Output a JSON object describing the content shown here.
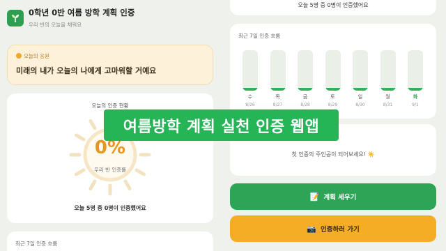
{
  "header": {
    "title": "0학년 0반 여름 방학 계획 인증",
    "subtitle": "우리 반의 오늘을 채워요",
    "logo_icon": "sprout-icon"
  },
  "cheer": {
    "label": "오늘의 응원",
    "message": "미래의 내가 오늘의 나에게 고마워할 거예요"
  },
  "status": {
    "title": "오늘의 인증 현황",
    "percent": "0%",
    "percent_value": 0,
    "percent_label": "우리 반 인증률",
    "summary": "오늘 5명 중 0명이 인증했어요"
  },
  "lower_left": {
    "title": "최근 7일 인증 흐름"
  },
  "right_top": {
    "text": "오늘 5명 중 0명이 인증했어요"
  },
  "week": {
    "title": "최근 7일 인증 흐름",
    "days": [
      {
        "name": "수",
        "date": "8/26",
        "rate": 0
      },
      {
        "name": "목",
        "date": "8/27",
        "rate": 0
      },
      {
        "name": "금",
        "date": "8/28",
        "rate": 0
      },
      {
        "name": "토",
        "date": "8/29",
        "rate": 0
      },
      {
        "name": "일",
        "date": "8/30",
        "rate": 0
      },
      {
        "name": "월",
        "date": "8/31",
        "rate": 0
      },
      {
        "name": "화",
        "date": "9/1",
        "rate": 0,
        "today": true
      }
    ]
  },
  "first": {
    "text": "첫 인증의 주인공이 되어보세요! ☀️"
  },
  "buttons": {
    "plan_label": "계획 세우기",
    "plan_icon": "memo-icon",
    "cert_label": "인증하러 가기",
    "cert_icon": "camera-icon"
  },
  "banner": {
    "text": "여름방학 계획 실천 인증 웹앱"
  },
  "colors": {
    "primary_green": "#2ea556",
    "accent_orange": "#f6ad26",
    "percent_orange": "#e8961e",
    "cheer_bg": "#fdf1da",
    "banner_green": "#25b456"
  }
}
